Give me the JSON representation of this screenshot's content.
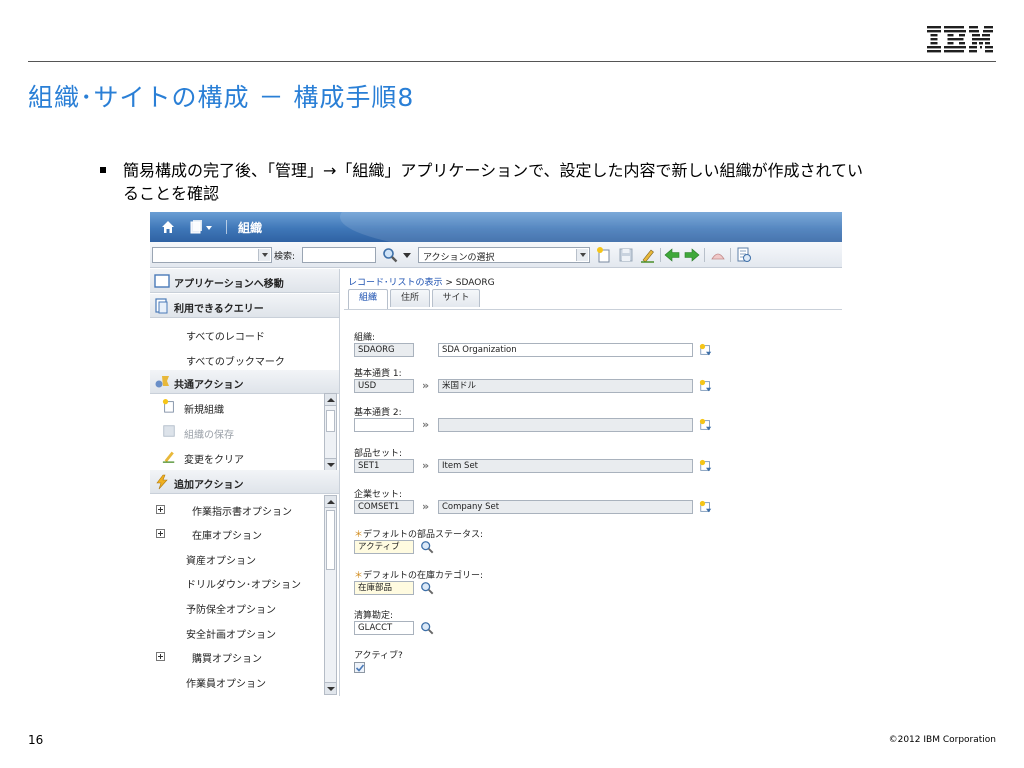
{
  "slide": {
    "title": "組織･サイトの構成 － 構成手順8",
    "bullet": "簡易構成の完了後、「管理」→「組織」アプリケーションで、設定した内容で新しい組織が作成されていることを確認",
    "page_number": "16",
    "copyright": "©2012 IBM Corporation",
    "logo_text": "IBM"
  },
  "app": {
    "title": "組織",
    "toolbar": {
      "search_label": "検索:",
      "action_select": "アクションの選択"
    },
    "sidebar": {
      "go_to_apps": "アプリケーションへ移動",
      "available_queries": "利用できるクエリー",
      "queries": [
        "すべてのレコード",
        "すべてのブックマーク"
      ],
      "common_actions": "共通アクション",
      "common_items": [
        {
          "label": "新規組織",
          "enabled": true,
          "icon": "new-record-icon"
        },
        {
          "label": "組織の保存",
          "enabled": false,
          "icon": "save-icon"
        },
        {
          "label": "変更をクリア",
          "enabled": true,
          "icon": "clear-changes-icon"
        }
      ],
      "more_actions": "追加アクション",
      "more_items": [
        {
          "label": "作業指示書オプション",
          "expandable": true
        },
        {
          "label": "在庫オプション",
          "expandable": true
        },
        {
          "label": "資産オプション",
          "expandable": false
        },
        {
          "label": "ドリルダウン･オプション",
          "expandable": false
        },
        {
          "label": "予防保全オプション",
          "expandable": false
        },
        {
          "label": "安全計画オプション",
          "expandable": false
        },
        {
          "label": "購買オプション",
          "expandable": true
        },
        {
          "label": "作業員オプション",
          "expandable": false
        }
      ]
    },
    "breadcrumb": {
      "link": "レコード･リストの表示",
      "separator": " > ",
      "current": "SDAORG"
    },
    "tabs": [
      "組織",
      "住所",
      "サイト"
    ],
    "form": {
      "org_label": "組織:",
      "org_code": "SDAORG",
      "org_desc": "SDA Organization",
      "base_cur1_label": "基本通貨 1:",
      "base_cur1_req": "",
      "base_cur1_code": "USD",
      "base_cur1_desc": "米国ドル",
      "base_cur2_label": "基本通貨 2:",
      "base_cur2_code": "",
      "base_cur2_desc": "",
      "itemset_label": "部品セット:",
      "itemset_code": "SET1",
      "itemset_desc": "Item Set",
      "companyset_label": "企業セット:",
      "companyset_code": "COMSET1",
      "companyset_desc": "Company Set",
      "default_item_status_label": "デフォルトの部品ステータス:",
      "default_item_status_value": "アクティブ",
      "default_stock_cat_label": "デフォルトの在庫カテゴリー:",
      "default_stock_cat_value": "在庫部品",
      "clearing_acct_label": "清算勘定:",
      "clearing_acct_value": "GLACCT",
      "active_label": "アクティブ?",
      "active_checked": true
    },
    "colors": {
      "title_blue": "#2a7fd6",
      "nav_blue": "#3f77b8",
      "link_blue": "#1a4fb0",
      "required_orange": "#d08a1a"
    }
  }
}
